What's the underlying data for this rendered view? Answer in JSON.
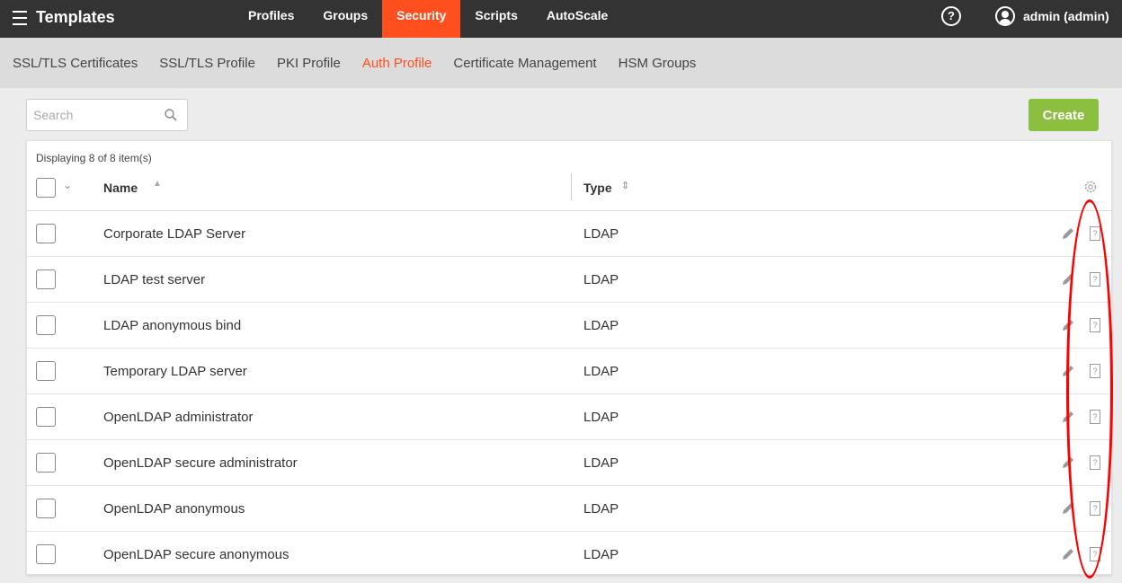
{
  "topbar": {
    "title": "Templates",
    "nav": [
      {
        "label": "Profiles",
        "active": false
      },
      {
        "label": "Groups",
        "active": false
      },
      {
        "label": "Security",
        "active": true
      },
      {
        "label": "Scripts",
        "active": false
      },
      {
        "label": "AutoScale",
        "active": false
      }
    ],
    "help_glyph": "?",
    "user_label": "admin (admin)"
  },
  "subnav": {
    "items": [
      {
        "label": "SSL/TLS Certificates",
        "active": false
      },
      {
        "label": "SSL/TLS Profile",
        "active": false
      },
      {
        "label": "PKI Profile",
        "active": false
      },
      {
        "label": "Auth Profile",
        "active": true
      },
      {
        "label": "Certificate Management",
        "active": false
      },
      {
        "label": "HSM Groups",
        "active": false
      }
    ]
  },
  "search": {
    "placeholder": "Search",
    "value": ""
  },
  "create_label": "Create",
  "table": {
    "count_text": "Displaying 8 of 8 item(s)",
    "columns": {
      "name": "Name",
      "type": "Type"
    },
    "rows": [
      {
        "name": "Corporate LDAP Server",
        "type": "LDAP"
      },
      {
        "name": "LDAP test server",
        "type": "LDAP"
      },
      {
        "name": "LDAP anonymous bind",
        "type": "LDAP"
      },
      {
        "name": "Temporary LDAP server",
        "type": "LDAP"
      },
      {
        "name": "OpenLDAP administrator",
        "type": "LDAP"
      },
      {
        "name": "OpenLDAP secure administrator",
        "type": "LDAP"
      },
      {
        "name": "OpenLDAP anonymous",
        "type": "LDAP"
      },
      {
        "name": "OpenLDAP secure anonymous",
        "type": "LDAP"
      }
    ],
    "delete_glyph": "?"
  },
  "colors": {
    "topbar_bg": "#333333",
    "accent": "#ff4f1f",
    "create_button": "#8cbf3f",
    "annotation": "#ff0000"
  },
  "icons": [
    "menu-icon",
    "help-icon",
    "avatar-icon",
    "search-icon",
    "gear-icon",
    "edit-icon",
    "delete-icon"
  ]
}
